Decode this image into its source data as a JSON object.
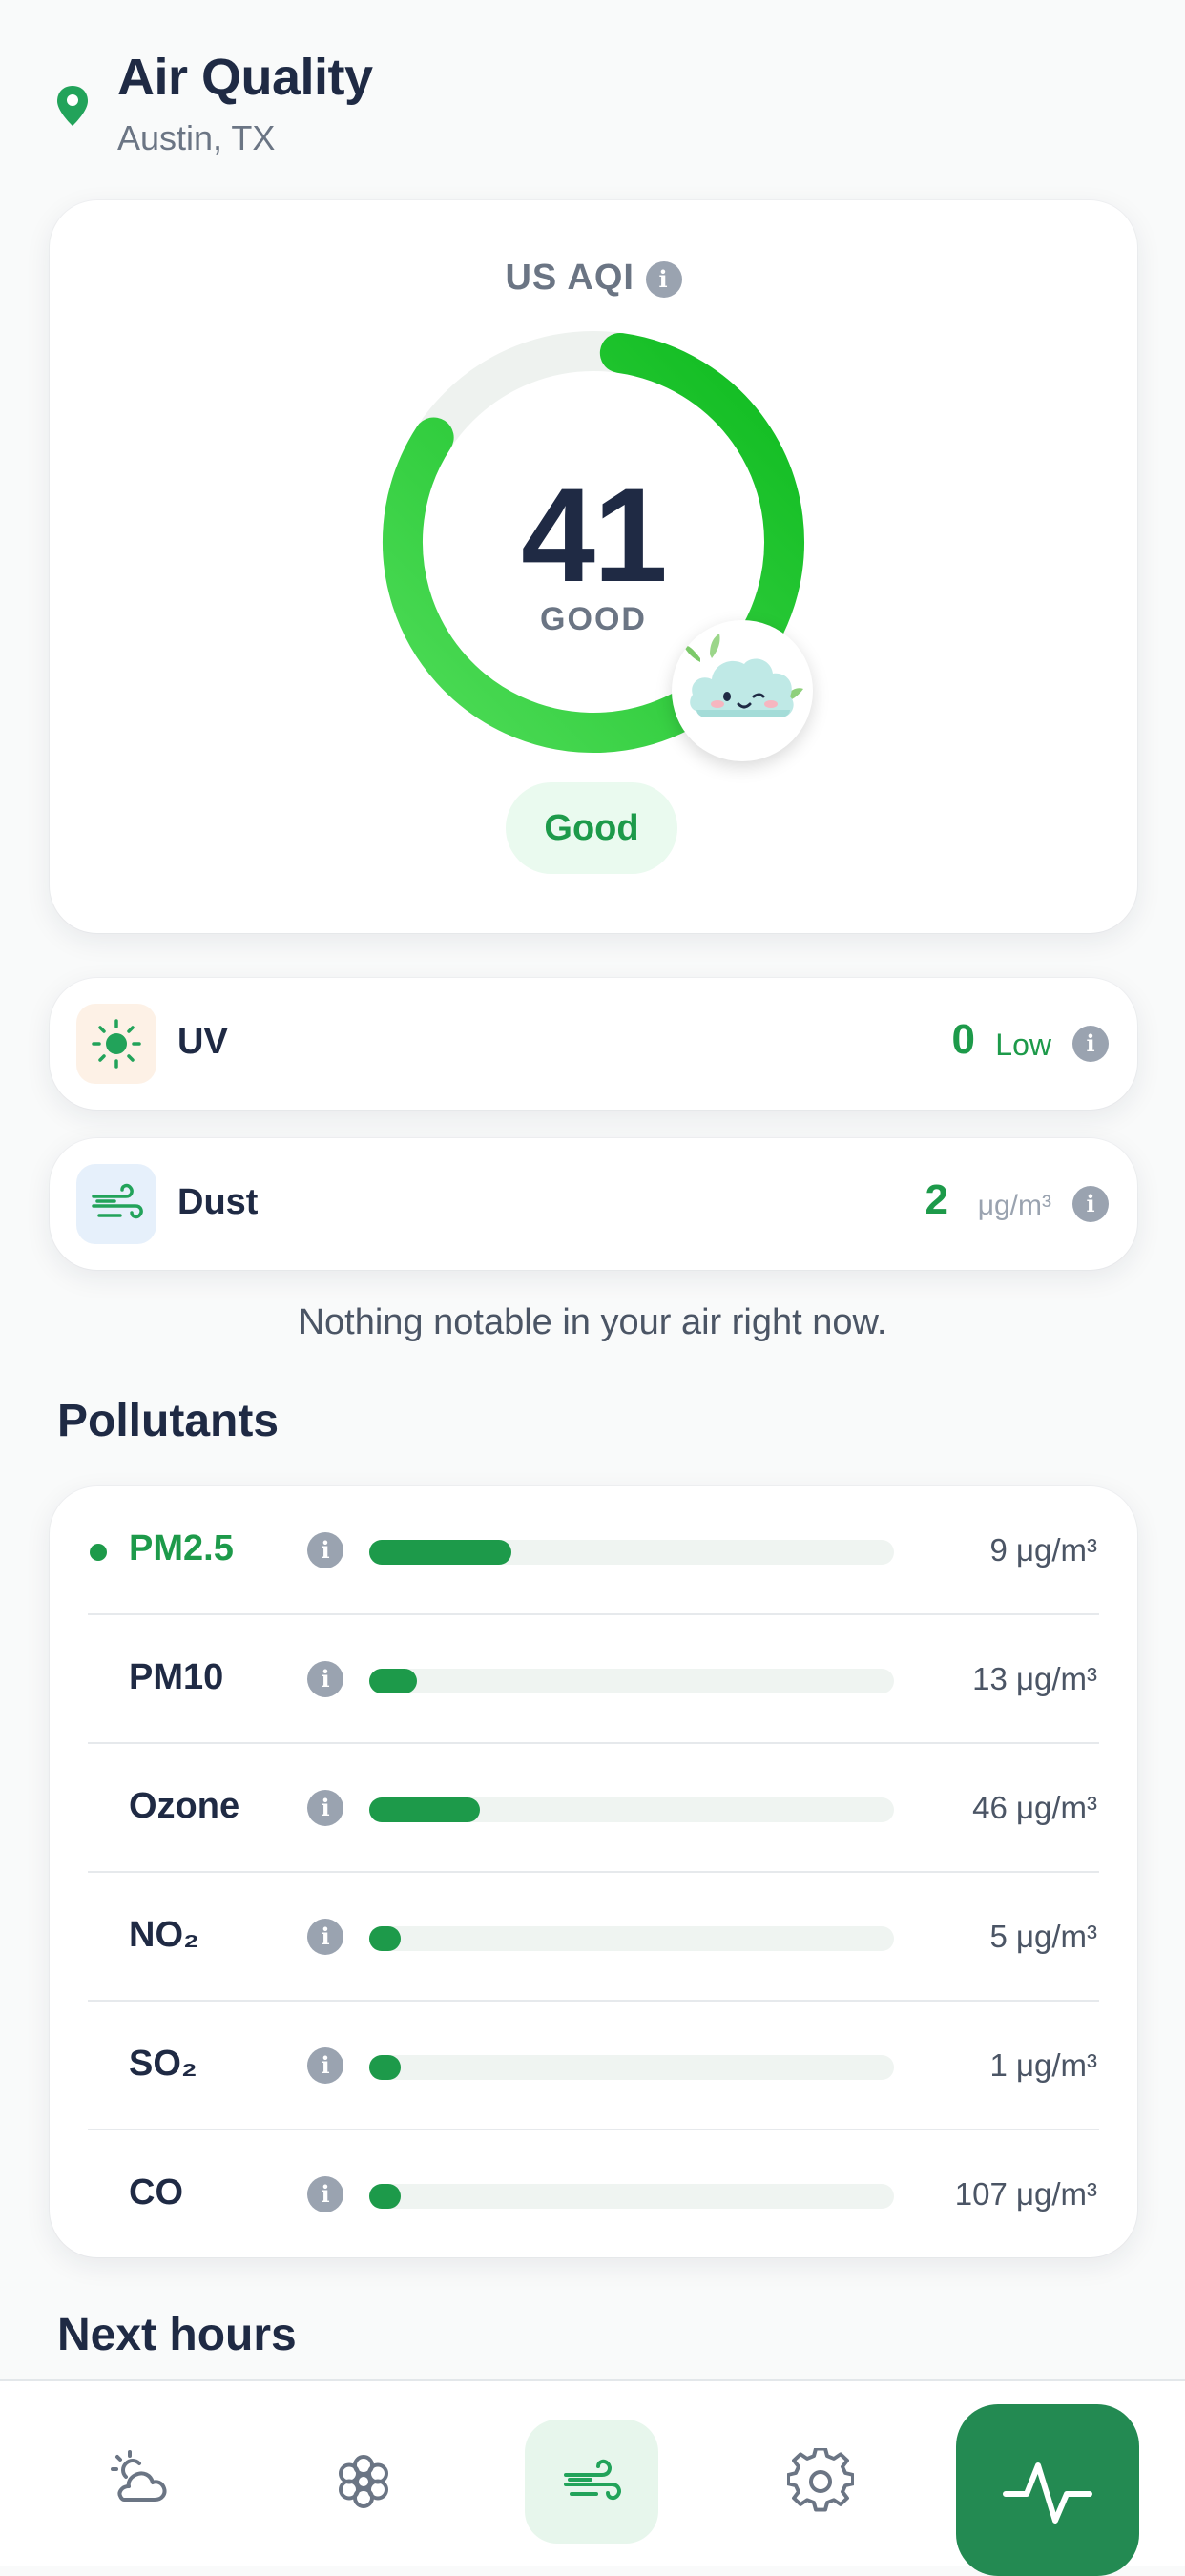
{
  "header": {
    "title": "Air Quality",
    "location": "Austin, TX"
  },
  "aqi": {
    "label": "US AQI",
    "value": "41",
    "category": "GOOD",
    "status": "Good",
    "gauge_fraction": 0.82,
    "accent": "#1d9a4a"
  },
  "uv": {
    "label": "UV",
    "value": "0",
    "level": "Low",
    "icon": "sun-icon"
  },
  "dust": {
    "label": "Dust",
    "value": "2",
    "unit": "μg/m³",
    "icon": "wind-icon"
  },
  "notice": "Nothing notable in your air right now.",
  "pollutants": {
    "title": "Pollutants",
    "items": [
      {
        "name": "PM2.5",
        "value": "9 μg/m³",
        "level": 0.27,
        "active": true
      },
      {
        "name": "PM10",
        "value": "13 μg/m³",
        "level": 0.09,
        "active": false
      },
      {
        "name": "Ozone",
        "value": "46 μg/m³",
        "level": 0.21,
        "active": false
      },
      {
        "name": "NO₂",
        "value": "5 μg/m³",
        "level": 0.06,
        "active": false
      },
      {
        "name": "SO₂",
        "value": "1 μg/m³",
        "level": 0.06,
        "active": false
      },
      {
        "name": "CO",
        "value": "107 μg/m³",
        "level": 0.06,
        "active": false
      }
    ]
  },
  "next_hours": {
    "title": "Next hours"
  },
  "nav": {
    "items": [
      "weather-icon",
      "flower-icon",
      "wind-icon",
      "gear-icon",
      "activity-icon"
    ],
    "active": "wind-icon"
  }
}
